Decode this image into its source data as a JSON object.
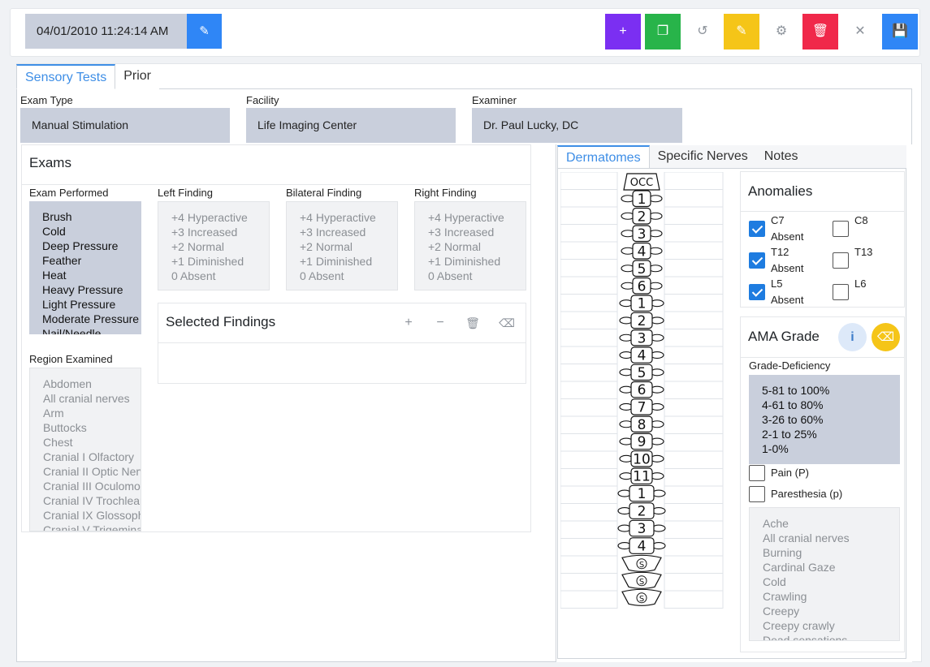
{
  "header": {
    "datetime": "04/01/2010 11:24:14 AM",
    "buttons": [
      {
        "name": "add-button",
        "icon": "plus-icon",
        "glyph": "+",
        "color": "#7b2ff2"
      },
      {
        "name": "copy-button",
        "icon": "copy-icon",
        "glyph": "❐",
        "color": "#28b44a"
      },
      {
        "name": "undo-button",
        "icon": "undo-icon",
        "glyph": "↺",
        "color": ""
      },
      {
        "name": "edit-button",
        "icon": "edit-icon",
        "glyph": "✎",
        "color": "#f5c518"
      },
      {
        "name": "settings-button",
        "icon": "gear-icon",
        "glyph": "⚙",
        "color": ""
      },
      {
        "name": "delete-button",
        "icon": "trash-icon",
        "glyph": "🗑",
        "color": "#f0284a"
      },
      {
        "name": "close-button",
        "icon": "close-icon",
        "glyph": "✕",
        "color": ""
      },
      {
        "name": "save-button",
        "icon": "save-icon",
        "glyph": "💾",
        "color": "#2f86f6"
      }
    ]
  },
  "tabs": [
    "Sensory Tests",
    "Prior"
  ],
  "fields": {
    "exam_type_label": "Exam Type",
    "exam_type": "Manual Stimulation",
    "facility_label": "Facility",
    "facility": "Life Imaging Center",
    "examiner_label": "Examiner",
    "examiner": "Dr. Paul Lucky, DC"
  },
  "exams": {
    "title": "Exams",
    "performed_label": "Exam Performed",
    "performed": [
      "Brush",
      "Cold",
      "Deep Pressure",
      "Feather",
      "Heat",
      "Heavy Pressure",
      "Light Pressure",
      "Moderate Pressure",
      "Nail/Needle"
    ],
    "left_label": "Left Finding",
    "bilateral_label": "Bilateral Finding",
    "right_label": "Right Finding",
    "findings": [
      "+4 Hyperactive",
      "+3 Increased",
      "+2 Normal",
      "+1 Diminished",
      "0 Absent"
    ],
    "region_label": "Region Examined",
    "regions": [
      "Abdomen",
      "All cranial nerves",
      "Arm",
      "Buttocks",
      "Chest",
      "Cranial I Olfactory",
      "Cranial II Optic Nerve",
      "Cranial III Oculomotor",
      "Cranial IV Trochlear",
      "Cranial IX Glossopharyngeal",
      "Cranial V Trigeminal"
    ],
    "selected_title": "Selected Findings"
  },
  "right_tabs": [
    "Dermatomes",
    "Specific Nerves",
    "Notes"
  ],
  "spine": {
    "occ": "OCC",
    "cervical": [
      "1",
      "2",
      "3",
      "4",
      "5",
      "6"
    ],
    "thoracic": [
      "1",
      "2",
      "3",
      "4",
      "5",
      "6",
      "7",
      "8",
      "9",
      "10",
      "11"
    ],
    "lumbar": [
      "1",
      "2",
      "3",
      "4"
    ],
    "sacral": [
      "S",
      "S",
      "S"
    ]
  },
  "anomalies": {
    "title": "Anomalies",
    "items": [
      {
        "label": "C7",
        "sub": "Absent",
        "checked": true
      },
      {
        "label": "C8",
        "sub": "",
        "checked": false
      },
      {
        "label": "T12",
        "sub": "Absent",
        "checked": true
      },
      {
        "label": "T13",
        "sub": "",
        "checked": false
      },
      {
        "label": "L5",
        "sub": "Absent",
        "checked": true
      },
      {
        "label": "L6",
        "sub": "",
        "checked": false
      }
    ]
  },
  "ama": {
    "title": "AMA Grade",
    "deficiency_label": "Grade-Deficiency",
    "grades": [
      "5-81 to 100%",
      "4-61 to 80%",
      "3-26 to 60%",
      "2-1 to 25%",
      "1-0%"
    ],
    "pain_label": "Pain (P)",
    "paresthesia_label": "Paresthesia (p)",
    "sensations": [
      "Ache",
      "All cranial nerves",
      "Burning",
      "Cardinal Gaze",
      "Cold",
      "Crawling",
      "Creepy",
      "Creepy crawly",
      "Dead sensations"
    ]
  }
}
